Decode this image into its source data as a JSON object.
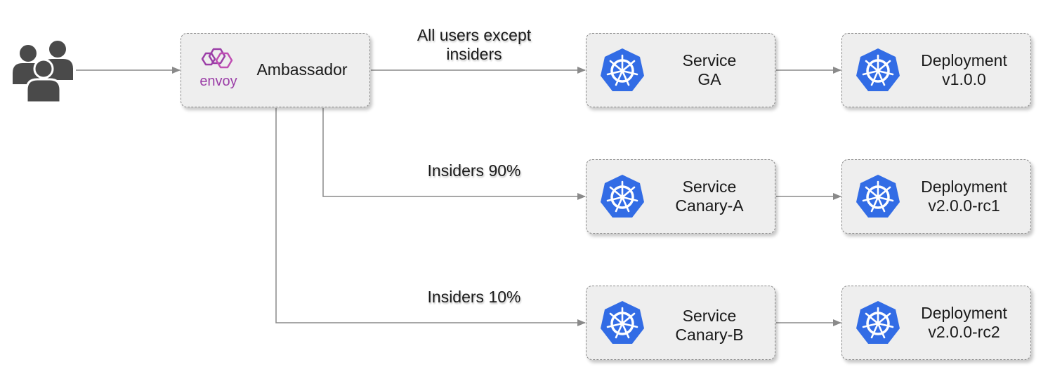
{
  "users": {
    "icon": "users-group-icon"
  },
  "ambassador": {
    "label": "Ambassador",
    "logo_text": "envoy",
    "logo_icon": "envoy-logo-icon",
    "logo_color": "#9b3ea7"
  },
  "edges": {
    "ga_line1": "All users except",
    "ga_line2": "insiders",
    "canary_a": "Insiders 90%",
    "canary_b": "Insiders 10%"
  },
  "services": [
    {
      "line1": "Service",
      "line2": "GA",
      "icon": "kubernetes-icon"
    },
    {
      "line1": "Service",
      "line2": "Canary-A",
      "icon": "kubernetes-icon"
    },
    {
      "line1": "Service",
      "line2": "Canary-B",
      "icon": "kubernetes-icon"
    }
  ],
  "deployments": [
    {
      "line1": "Deployment",
      "line2": "v1.0.0",
      "icon": "kubernetes-icon"
    },
    {
      "line1": "Deployment",
      "line2": "v2.0.0-rc1",
      "icon": "kubernetes-icon"
    },
    {
      "line1": "Deployment",
      "line2": "v2.0.0-rc2",
      "icon": "kubernetes-icon"
    }
  ],
  "colors": {
    "kubernetes_blue": "#326ce5",
    "connector_gray": "#8a8a8a",
    "node_fill": "#eeeeee",
    "users_gray": "#4a4a4a"
  }
}
